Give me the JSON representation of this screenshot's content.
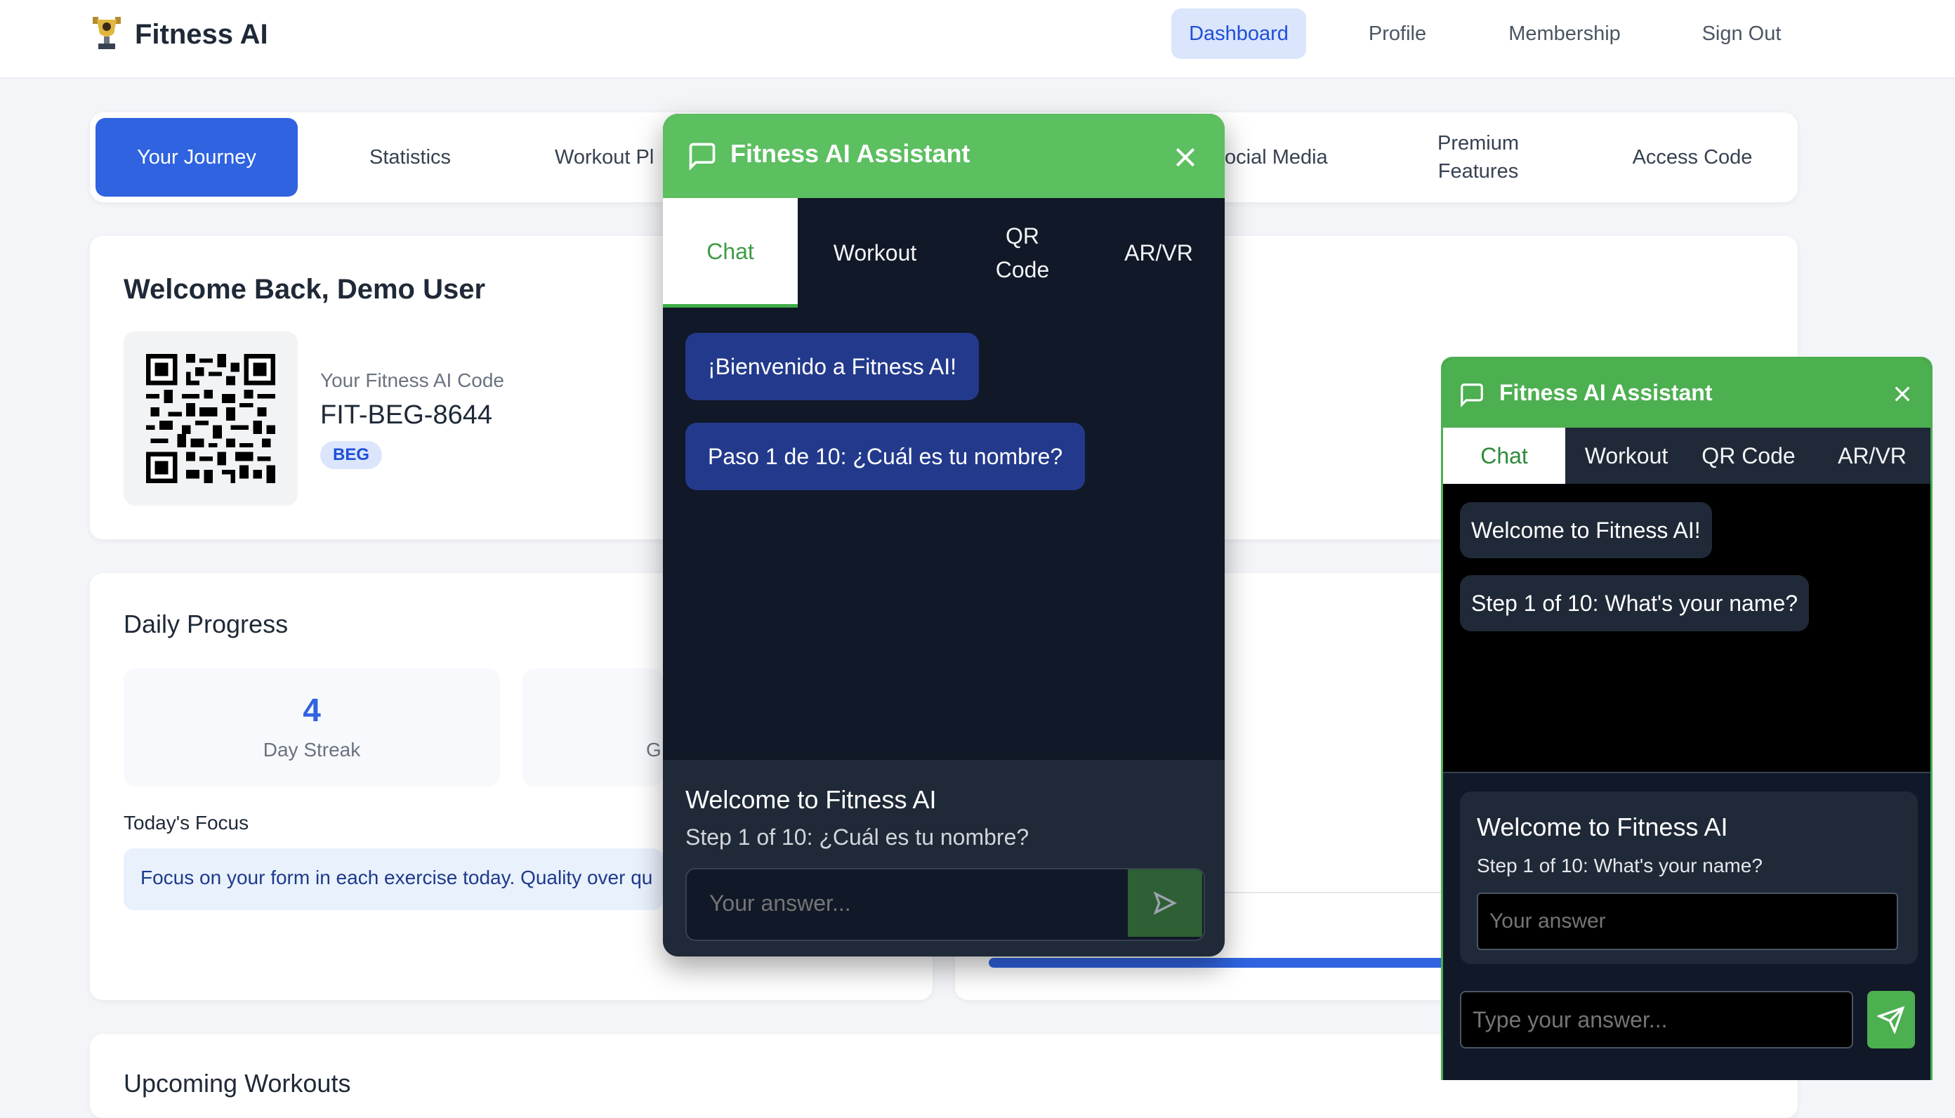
{
  "app": {
    "title": "Fitness AI"
  },
  "nav": {
    "dashboard": "Dashboard",
    "profile": "Profile",
    "membership": "Membership",
    "signout": "Sign Out"
  },
  "tabs": {
    "journey": "Your Journey",
    "statistics": "Statistics",
    "workout_plan": "Workout Pl",
    "social_media": "ocial Media",
    "premium": "Premium Features",
    "access_code": "Access Code"
  },
  "welcome": {
    "title": "Welcome Back, Demo User",
    "code_label": "Your Fitness AI Code",
    "code_value": "FIT-BEG-8644",
    "badge": "BEG"
  },
  "progress": {
    "title": "Daily Progress",
    "streak_value": "4",
    "streak_label": "Day Streak",
    "second_label_partial": "G",
    "focus_label": "Today's Focus",
    "focus_text": "Focus on your form in each exercise today. Quality over qu",
    "progress_fraction": 0.75
  },
  "bottom_card": {
    "title_partial": "Upcoming Workouts"
  },
  "chat_large": {
    "title": "Fitness AI Assistant",
    "tabs": [
      "Chat",
      "Workout",
      "QR Code",
      "AR/VR"
    ],
    "messages": [
      "¡Bienvenido a Fitness AI!",
      "Paso 1 de 10: ¿Cuál es tu nombre?"
    ],
    "footer_title": "Welcome to Fitness AI",
    "footer_step": "Step 1 of 10: ¿Cuál es tu nombre?",
    "input_placeholder": "Your answer..."
  },
  "chat_small": {
    "title": "Fitness AI Assistant",
    "tabs": [
      "Chat",
      "Workout",
      "QR Code",
      "AR/VR"
    ],
    "messages": [
      "Welcome to Fitness AI!",
      "Step 1 of 10: What's your name?"
    ],
    "form_title": "Welcome to Fitness AI",
    "form_step": "Step 1 of 10: What's your name?",
    "form_placeholder": "Your answer",
    "input_placeholder": "Type your answer..."
  },
  "colors": {
    "primary": "#2f63e0",
    "chat_green": "#5cbf60",
    "chat_dark": "#111827",
    "bubble_blue": "#233a8c"
  }
}
